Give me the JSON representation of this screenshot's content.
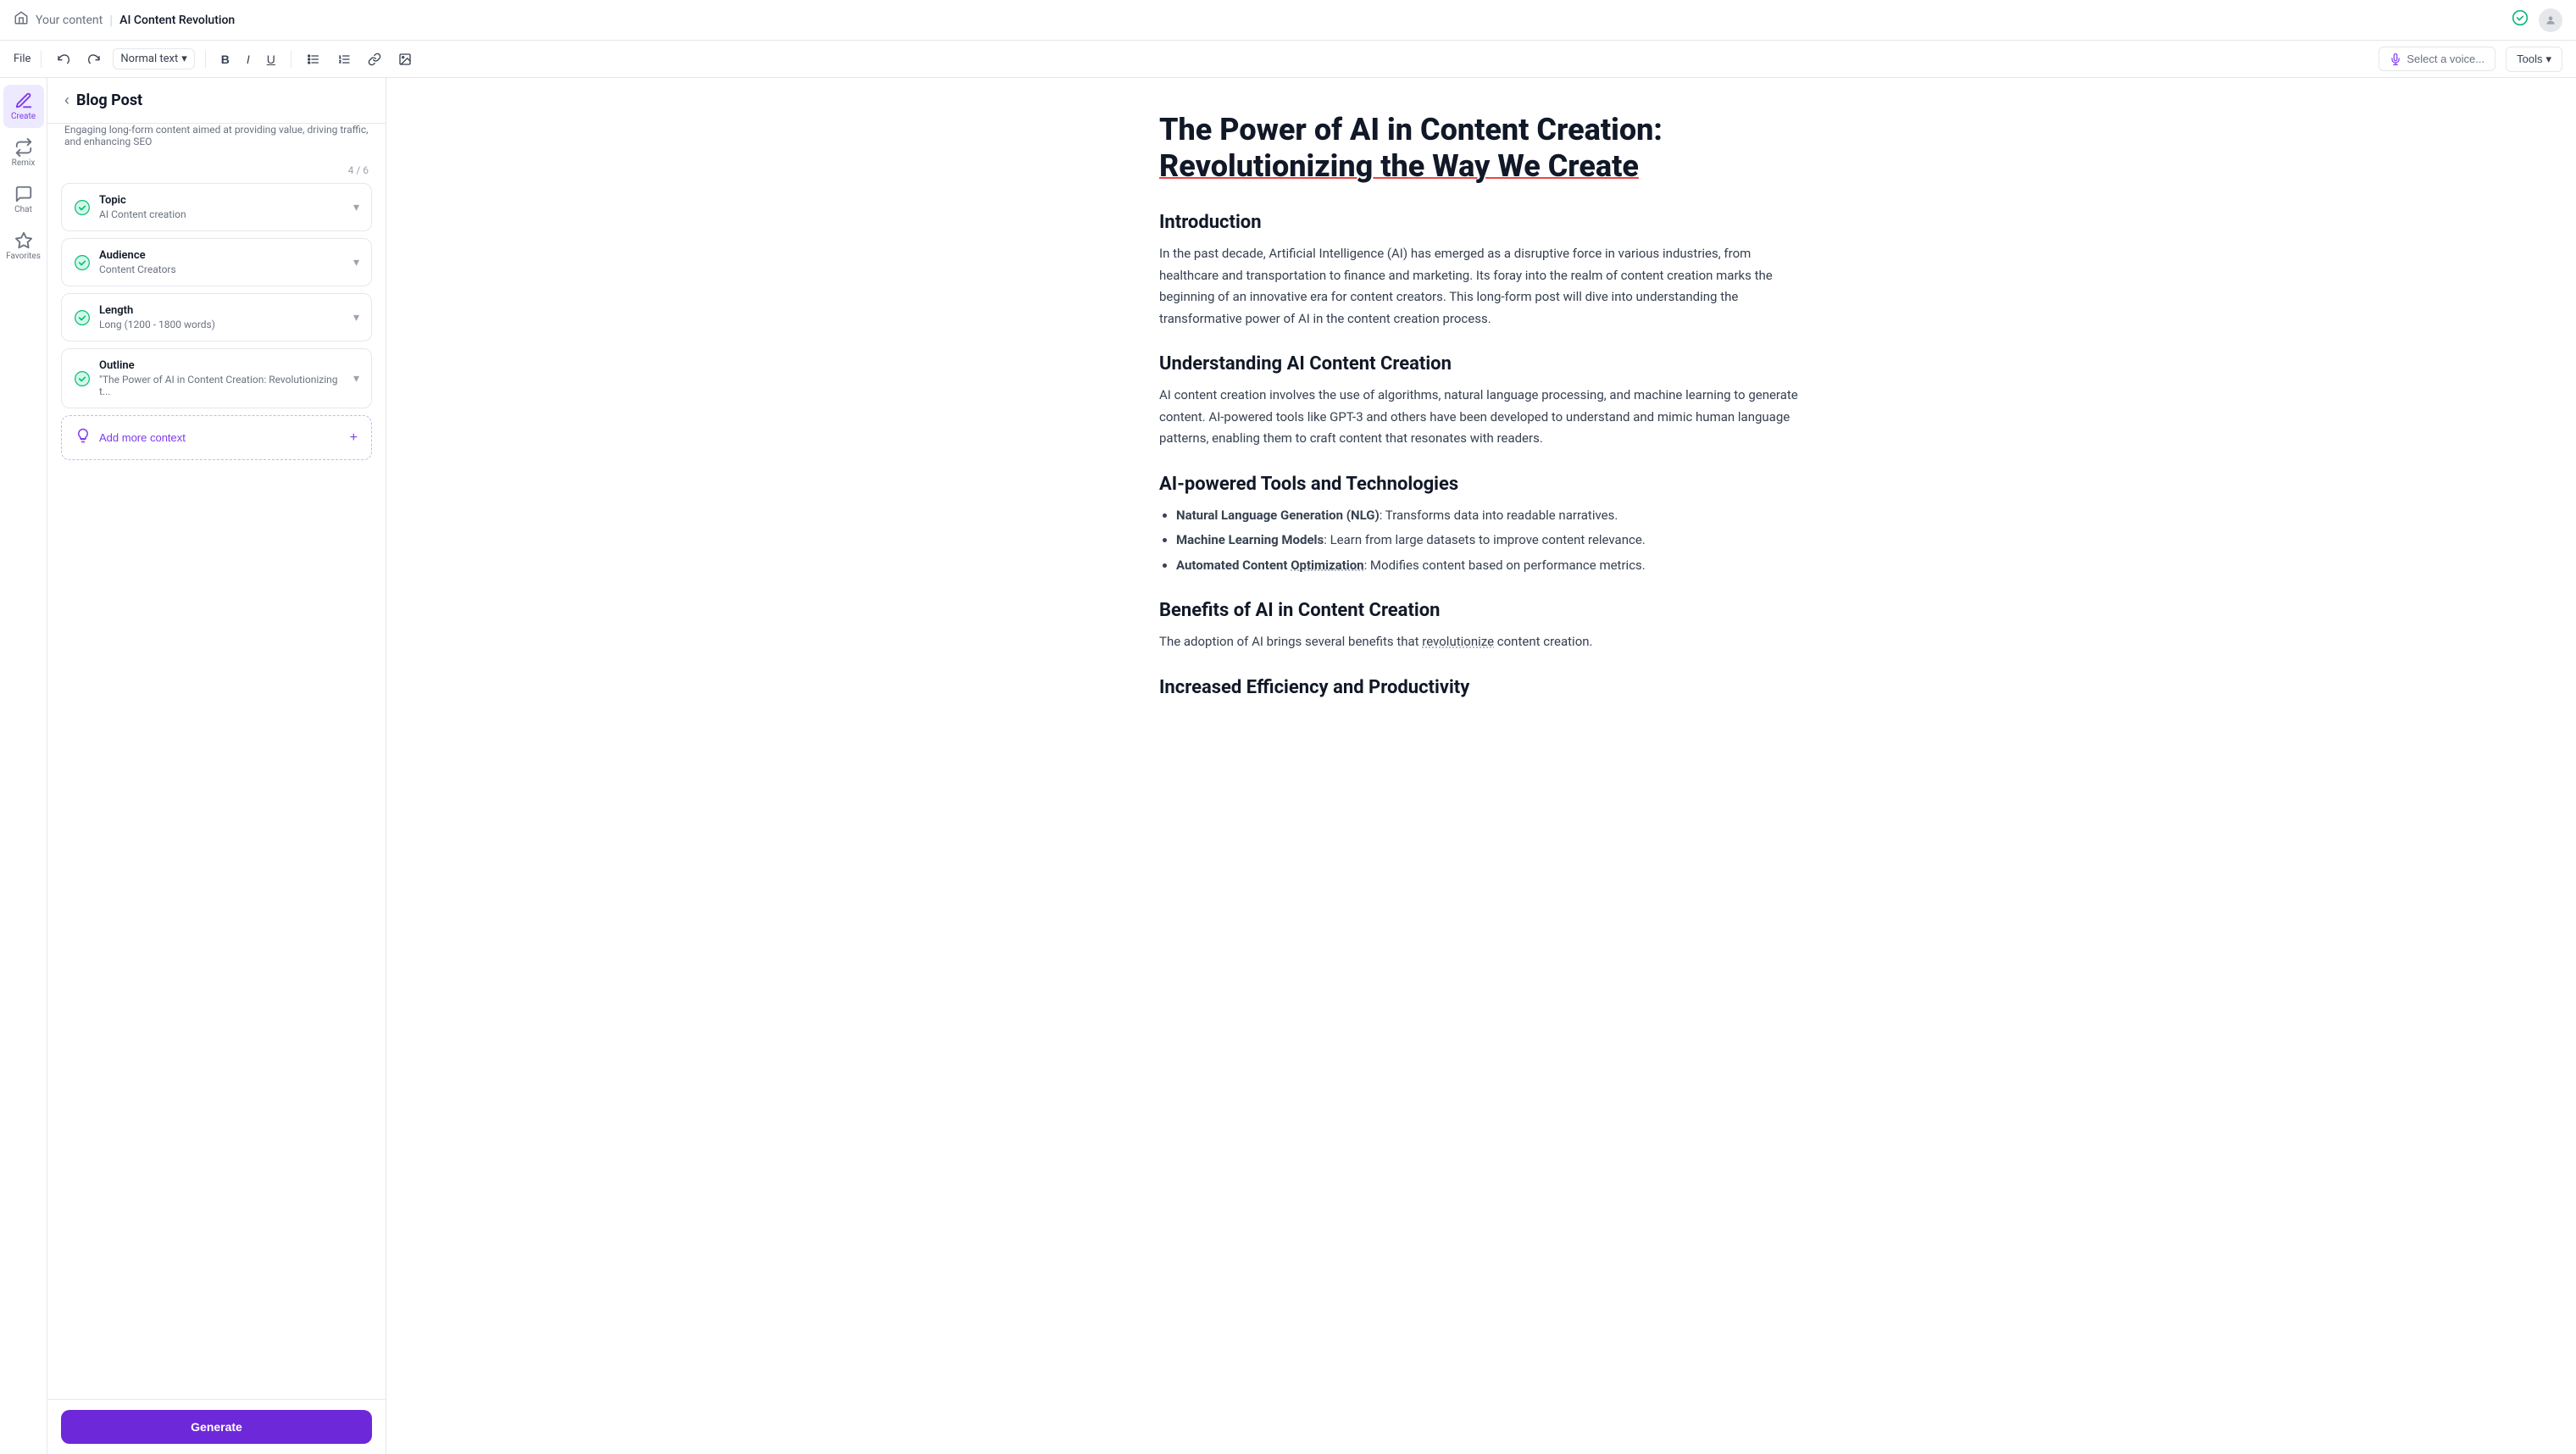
{
  "topbar": {
    "home_icon": "🏠",
    "breadcrumb": "Your content",
    "separator": "|",
    "title": "AI Content Revolution",
    "check_icon": "✓",
    "user_initial": "U"
  },
  "toolbar": {
    "file_label": "File",
    "undo_icon": "↩",
    "redo_icon": "↪",
    "text_style": "Normal text",
    "bold_icon": "B",
    "italic_icon": "I",
    "underline_icon": "U",
    "bullet_icon": "≡",
    "number_icon": "≣",
    "link_icon": "🔗",
    "image_icon": "🖼",
    "select_voice_label": "Select a voice...",
    "tools_label": "Tools"
  },
  "sidebar": {
    "items": [
      {
        "id": "create",
        "label": "Create",
        "active": true
      },
      {
        "id": "remix",
        "label": "Remix",
        "active": false
      },
      {
        "id": "chat",
        "label": "Chat",
        "active": false
      },
      {
        "id": "favorites",
        "label": "Favorites",
        "active": false
      }
    ]
  },
  "panel": {
    "back_icon": "‹",
    "title": "Blog Post",
    "subtitle": "Engaging long-form content aimed at providing value, driving traffic, and enhancing SEO",
    "counter": "4 / 6",
    "form_rows": [
      {
        "id": "topic",
        "label": "Topic",
        "value": "AI Content creation",
        "checked": true
      },
      {
        "id": "audience",
        "label": "Audience",
        "value": "Content Creators",
        "checked": true
      },
      {
        "id": "length",
        "label": "Length",
        "value": "Long (1200 - 1800 words)",
        "checked": true
      },
      {
        "id": "outline",
        "label": "Outline",
        "value": "\"The Power of AI in Content Creation: Revolutionizing t...",
        "checked": true
      }
    ],
    "add_context_label": "Add more context",
    "generate_label": "Generate"
  },
  "editor": {
    "title_part1": "The Power of AI in Content Creation:",
    "title_part2": "Revolutionizing the Way We Create",
    "sections": [
      {
        "heading": "Introduction",
        "content": "In the past decade, Artificial Intelligence (AI) has emerged as a disruptive force in various industries, from healthcare and transportation to finance and marketing. Its foray into the realm of content creation marks the beginning of an innovative era for content creators. This long-form post will dive into understanding the transformative power of AI in the content creation process."
      },
      {
        "heading": "Understanding AI Content Creation",
        "content": "AI content creation involves the use of algorithms, natural language processing, and machine learning to generate content. AI-powered tools like GPT-3 and others have been developed to understand and mimic human language patterns, enabling them to craft content that resonates with readers."
      },
      {
        "heading": "AI-powered Tools and Technologies",
        "bullets": [
          {
            "bold": "Natural Language Generation (NLG)",
            "rest": ": Transforms data into readable narratives."
          },
          {
            "bold": "Machine Learning Models",
            "rest": ": Learn from large datasets to improve content relevance."
          },
          {
            "bold": "Automated Content Optimization",
            "rest": ": Modifies content based on performance metrics.",
            "underline": true
          }
        ]
      },
      {
        "heading": "Benefits of AI in Content Creation",
        "content": "The adoption of AI brings several benefits that revolutionize content creation."
      },
      {
        "heading": "Increased Efficiency and Productivity"
      }
    ]
  }
}
